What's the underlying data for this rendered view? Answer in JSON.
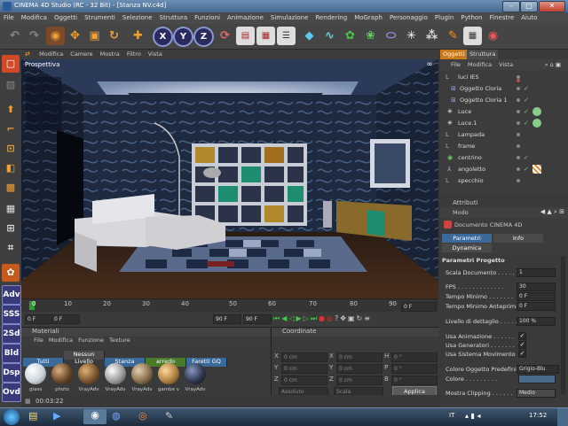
{
  "window": {
    "title": "CINEMA 4D Studio (RC - 32 Bit) - [Stanza NV.c4d]",
    "minimize": "–",
    "maximize": "□",
    "close": "✕"
  },
  "menubar": [
    "File",
    "Modifica",
    "Oggetti",
    "Strumenti",
    "Selezione",
    "Struttura",
    "Funzioni",
    "Animazione",
    "Simulazione",
    "Rendering",
    "MoGraph",
    "Personaggio",
    "Plugin",
    "Python",
    "Finestre",
    "Aiuto"
  ],
  "toolbar": {
    "x_label": "X",
    "y_label": "Y",
    "z_label": "Z"
  },
  "left_toolbar": {
    "adv": "Adv",
    "sss": "SSS",
    "d2": "2Sd",
    "bld": "Bld",
    "dsp": "Dsp",
    "ovd": "Ovd"
  },
  "viewport": {
    "menu": [
      "Modifica",
      "Camere",
      "Mostra",
      "Filtro",
      "Vista"
    ],
    "label": "Prospettiva"
  },
  "timeline": {
    "ticks": [
      "0",
      "10",
      "20",
      "30",
      "40",
      "50",
      "60",
      "70",
      "80",
      "90"
    ],
    "current_frame": "0 F",
    "start_field": "0 F",
    "end_field": "90 F",
    "max_field": "90 F",
    "left_field": "0 F"
  },
  "materials": {
    "header": "Materiali",
    "menu": [
      "File",
      "Modifica",
      "Funzione",
      "Texture"
    ],
    "tabs": [
      "Tutti",
      "Nessun Livello",
      "Stanza",
      "arredo",
      "Faretti GQ"
    ],
    "items": [
      {
        "label": "glass",
        "color": "#c9d4dc"
      },
      {
        "label": "photo",
        "color": "#6b4a2a"
      },
      {
        "label": "VrayAdv",
        "color": "#7a5530"
      },
      {
        "label": "VrayAdv",
        "color": "#9a9a9a"
      },
      {
        "label": "VrayAdv",
        "color": "#8a7050"
      },
      {
        "label": "gambe v",
        "color": "#b08040"
      },
      {
        "label": "VrayAdv",
        "color": "#303850"
      }
    ]
  },
  "coordinates": {
    "header": "Coordinate",
    "x": "X",
    "y": "Y",
    "z": "Z",
    "h": "H",
    "p": "P",
    "b": "B",
    "zero_cm": "0 cm",
    "zero_deg": "0 °",
    "mode_select": "Assoluto",
    "scale_select": "Scala",
    "apply": "Applica"
  },
  "object_manager": {
    "tabs": [
      "Oggetti",
      "Struttura"
    ],
    "menu": [
      "File",
      "Modifica",
      "Vista"
    ],
    "objects": [
      {
        "name": "luci IES",
        "indent": 0,
        "icon": "L0"
      },
      {
        "name": "Oggetto Cloria",
        "indent": 1,
        "icon": "⊞"
      },
      {
        "name": "Oggetto Cloria 1",
        "indent": 1,
        "icon": "⊞"
      },
      {
        "name": "Luce",
        "indent": 0,
        "icon": "✳"
      },
      {
        "name": "Luce.1",
        "indent": 0,
        "icon": "✳"
      },
      {
        "name": "Lampada",
        "indent": 0,
        "icon": "L0"
      },
      {
        "name": "frame",
        "indent": 0,
        "icon": "L0"
      },
      {
        "name": "centrino",
        "indent": 0,
        "icon": "◉"
      },
      {
        "name": "angoletto",
        "indent": 0,
        "icon": "⅄"
      },
      {
        "name": "specchio",
        "indent": 0,
        "icon": "L0"
      }
    ]
  },
  "attributes": {
    "header": "Attributi",
    "mode": "Modo",
    "doc_title": "Documento CINEMA 4D",
    "tabs": [
      "Parametri Progetto",
      "Info",
      "Dynamica"
    ],
    "section": "Parametri Progetto",
    "rows": [
      {
        "label": "Scala Documento . . . . .",
        "value": "1"
      },
      {
        "label": "FPS . . . . . . . . . . . . .",
        "value": "30"
      },
      {
        "label": "Tempo Minimo . . . . . . .",
        "value": "0 F"
      },
      {
        "label": "Tempo Minimo Anteprima",
        "value": "0 F"
      },
      {
        "label": "Livello di dettaglio . . . . .",
        "value": "100 %"
      }
    ],
    "checks": [
      {
        "label": "Usa Animazione . . . . . .",
        "checked": "✓"
      },
      {
        "label": "Usa Generatori . . . . . . .",
        "checked": "✓"
      },
      {
        "label": "Usa Sistema Movimento",
        "checked": "✓"
      }
    ],
    "color_label": "Colore Oggetto Predefinito",
    "color_value": "Grigio-Blu",
    "colore_label": "Colore . . . . . . . . .",
    "clipping_label": "Mostra Clipping . . . . . .",
    "clipping_value": "Medio"
  },
  "status": {
    "time": "00:03:22"
  },
  "taskbar": {
    "lang": "IT",
    "clock": "17:52"
  }
}
